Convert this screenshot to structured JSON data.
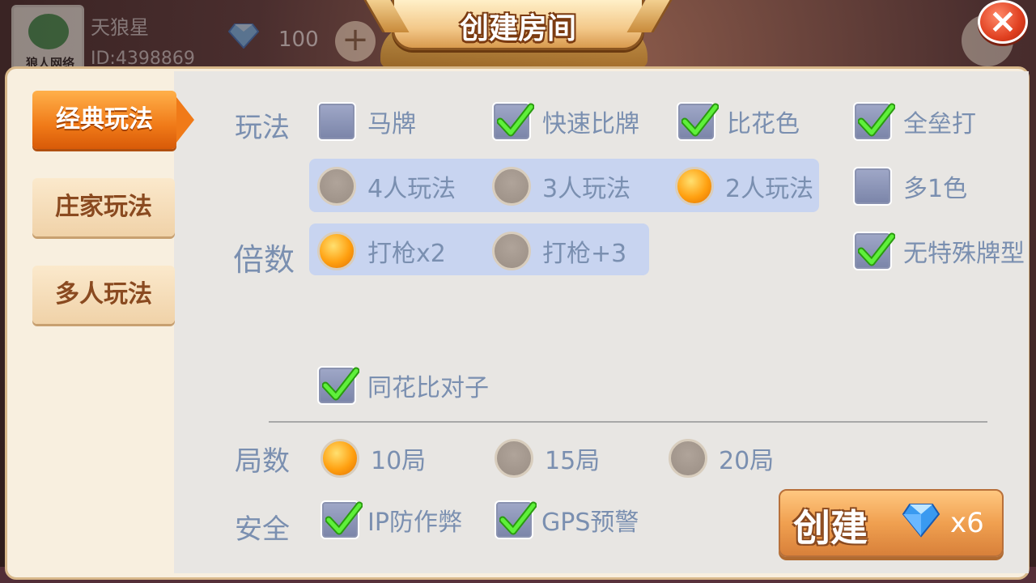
{
  "header": {
    "title": "创建房间",
    "close_icon": "×",
    "player_name": "天狼星",
    "player_id": "ID:4398869",
    "gem_count": "100",
    "plus_icon": "+",
    "logo_text": "狼人网络"
  },
  "sidebar": {
    "tabs": [
      {
        "label": "经典玩法",
        "active": true
      },
      {
        "label": "庄家玩法",
        "active": false
      },
      {
        "label": "多人玩法",
        "active": false
      }
    ]
  },
  "options": {
    "wanfa_label": "玩法",
    "beishu_label": "倍数",
    "jushu_label": "局数",
    "anquan_label": "安全",
    "mapai": {
      "label": "马牌",
      "checked": false
    },
    "kuaisu": {
      "label": "快速比牌",
      "checked": true
    },
    "bihuase": {
      "label": "比花色",
      "checked": true
    },
    "quanleida": {
      "label": "全垒打",
      "checked": true
    },
    "players": [
      {
        "label": "4人玩法",
        "selected": false
      },
      {
        "label": "3人玩法",
        "selected": false
      },
      {
        "label": "2人玩法",
        "selected": true
      }
    ],
    "duoyise": {
      "label": "多1色",
      "checked": false
    },
    "multiplier": [
      {
        "label": "打枪x2",
        "selected": true
      },
      {
        "label": "打枪+3",
        "selected": false
      }
    ],
    "wuteshu": {
      "label": "无特殊牌型",
      "checked": true
    },
    "tonghua": {
      "label": "同花比对子",
      "checked": true
    },
    "rounds": [
      {
        "label": "10局",
        "selected": true
      },
      {
        "label": "15局",
        "selected": false
      },
      {
        "label": "20局",
        "selected": false
      }
    ],
    "ip": {
      "label": "IP防作弊",
      "checked": true
    },
    "gps": {
      "label": "GPS预警",
      "checked": true
    }
  },
  "create": {
    "label": "创建",
    "cost": "x6"
  },
  "colors": {
    "accent_orange": "#f07a18",
    "label_blue": "#7a8fb0",
    "check_green": "#3ecc1a"
  }
}
